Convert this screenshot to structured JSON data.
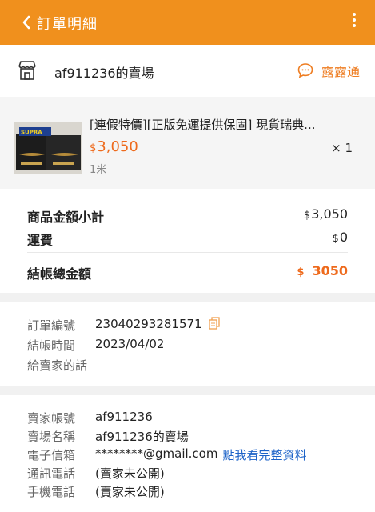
{
  "header": {
    "title": "訂單明細"
  },
  "shop": {
    "name": "af911236的賣場",
    "chat_label": "露露通"
  },
  "product": {
    "title": "[連假特價][正版免運提供保固] 現貨瑞典...",
    "currency": "$",
    "price": "3,050",
    "qty": "× 1",
    "spec": "1米",
    "image_label": "SUPRA Cables"
  },
  "totals": {
    "subtotal_label": "商品金額小計",
    "subtotal_currency": "$",
    "subtotal_value": "3,050",
    "shipping_label": "運費",
    "shipping_currency": "$",
    "shipping_value": "0",
    "total_label": "結帳總金額",
    "total_currency": "$",
    "total_value": "3050"
  },
  "order": {
    "number_label": "訂單編號",
    "number_value": "23040293281571",
    "time_label": "結帳時間",
    "time_value": "2023/04/02",
    "message_label": "給賣家的話",
    "message_value": ""
  },
  "seller": {
    "account_label": "賣家帳號",
    "account_value": "af911236",
    "store_label": "賣場名稱",
    "store_value": "af911236的賣場",
    "email_label": "電子信箱",
    "email_value": "********@gmail.com",
    "email_link": "點我看完整資料",
    "phone_label": "通訊電話",
    "phone_value": "(賣家未公開)",
    "mobile_label": "手機電話",
    "mobile_value": "(賣家未公開)"
  },
  "colors": {
    "brand": "#f0901d",
    "accent": "#ee6a1c",
    "link": "#1d63c8"
  }
}
